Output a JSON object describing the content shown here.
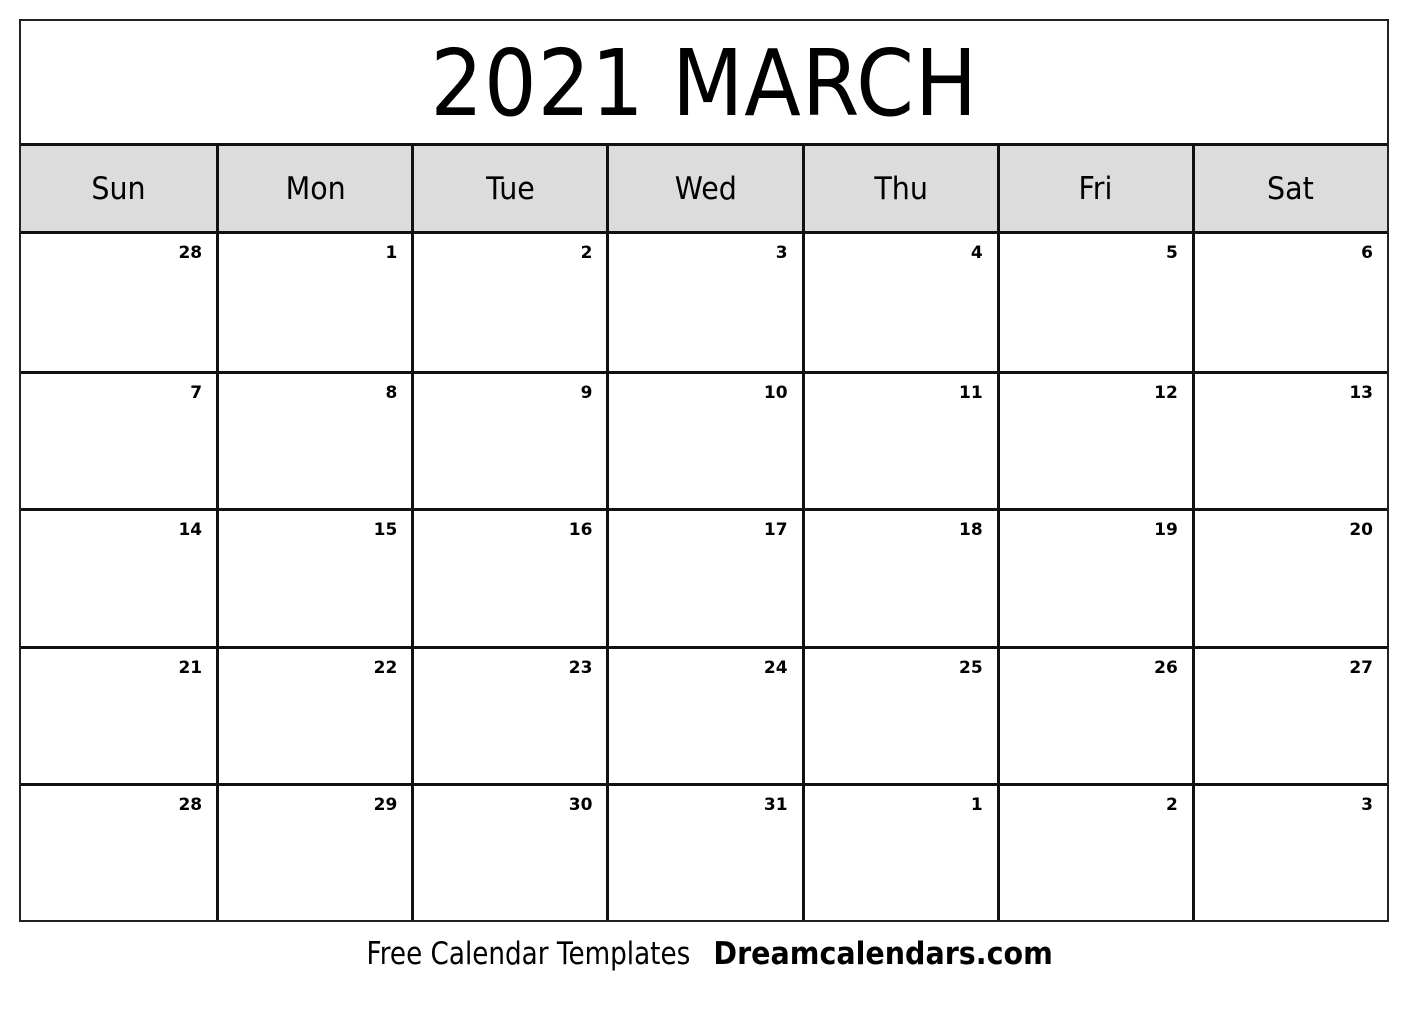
{
  "title": "2021 MARCH",
  "weekdays": [
    "Sun",
    "Mon",
    "Tue",
    "Wed",
    "Thu",
    "Fri",
    "Sat"
  ],
  "weeks": [
    [
      "28",
      "1",
      "2",
      "3",
      "4",
      "5",
      "6"
    ],
    [
      "7",
      "8",
      "9",
      "10",
      "11",
      "12",
      "13"
    ],
    [
      "14",
      "15",
      "16",
      "17",
      "18",
      "19",
      "20"
    ],
    [
      "21",
      "22",
      "23",
      "24",
      "25",
      "26",
      "27"
    ],
    [
      "28",
      "29",
      "30",
      "31",
      "1",
      "2",
      "3"
    ]
  ],
  "footer": {
    "text": "Free Calendar Templates",
    "site": "Dreamcalendars.com"
  },
  "colors": {
    "header_background": "#dcdcdc",
    "border": "#111111"
  }
}
